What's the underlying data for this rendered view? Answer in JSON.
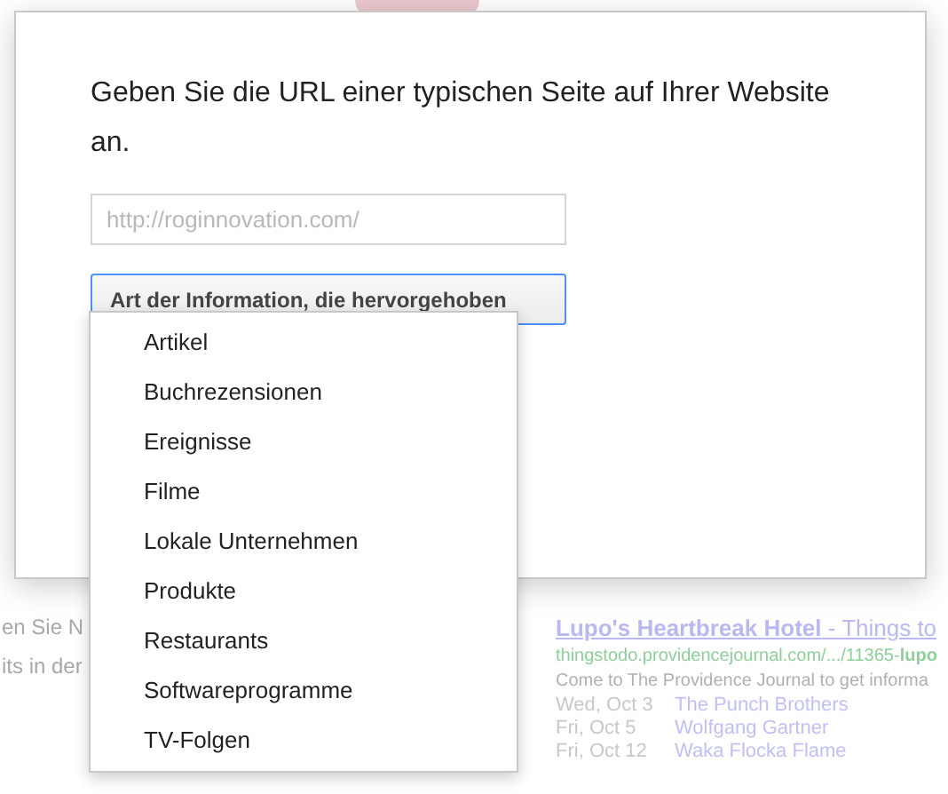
{
  "background": {
    "left_lines": [
      "en Sie N",
      "its in der"
    ],
    "result": {
      "title": "**Lupo's Heartbreak Hotel** - Things to",
      "url": "thingstodo.providencejournal.com/.../11365-**lupo**",
      "snippet": "Come to The Providence Journal to get informa",
      "events": [
        {
          "date": "Wed, Oct 3",
          "name": "The Punch Brothers"
        },
        {
          "date": "Fri, Oct 5",
          "name": "Wolfgang Gartner"
        },
        {
          "date": "Fri, Oct 12",
          "name": "Waka Flocka Flame"
        }
      ]
    }
  },
  "dialog": {
    "prompt": "Geben Sie die URL einer typischen Seite auf Ihrer Website an.",
    "url_field": {
      "placeholder": "http://roginnovation.com/"
    },
    "type_select": {
      "label": "Art der Information, die hervorgehoben",
      "expanded": true
    },
    "options": [
      "Artikel",
      "Buchrezensionen",
      "Ereignisse",
      "Filme",
      "Lokale Unternehmen",
      "Produkte",
      "Restaurants",
      "Softwareprogramme",
      "TV-Folgen"
    ]
  }
}
